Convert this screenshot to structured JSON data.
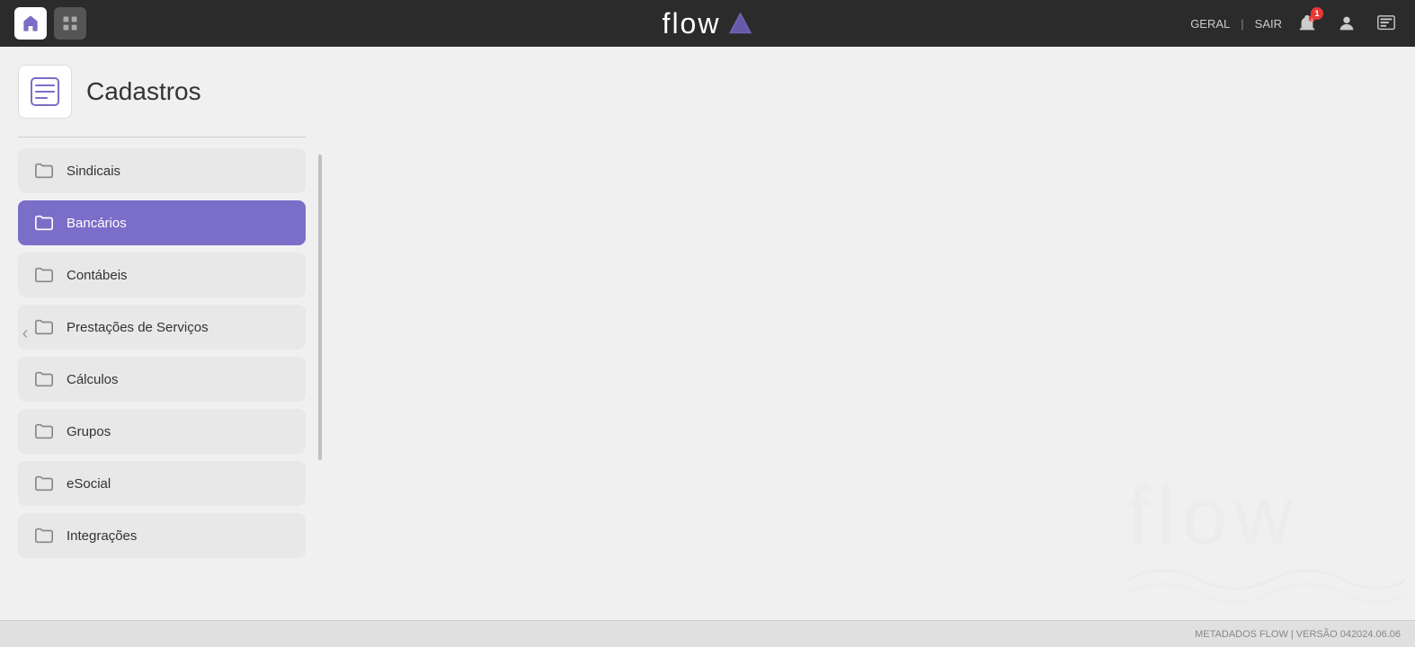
{
  "app": {
    "title": "flow",
    "version_label": "METADADOS FLOW | VERSÃO 042024.06.06"
  },
  "topbar": {
    "home_label": "Home",
    "grid_label": "Menu",
    "geral_label": "GERAL",
    "sair_label": "SAIR",
    "separator": "|",
    "notification_count": "1"
  },
  "page": {
    "title": "Cadastros",
    "icon_alt": "Cadastros icon"
  },
  "menu": {
    "items": [
      {
        "label": "Sindicais",
        "active": false
      },
      {
        "label": "Bancários",
        "active": true
      },
      {
        "label": "Contábeis",
        "active": false
      },
      {
        "label": "Prestações de Serviços",
        "active": false
      },
      {
        "label": "Cálculos",
        "active": false
      },
      {
        "label": "Grupos",
        "active": false
      },
      {
        "label": "eSocial",
        "active": false
      },
      {
        "label": "Integrações",
        "active": false
      }
    ]
  },
  "footer": {
    "version_text": "METADADOS FLOW | VERSÃO 042024.06.06"
  }
}
